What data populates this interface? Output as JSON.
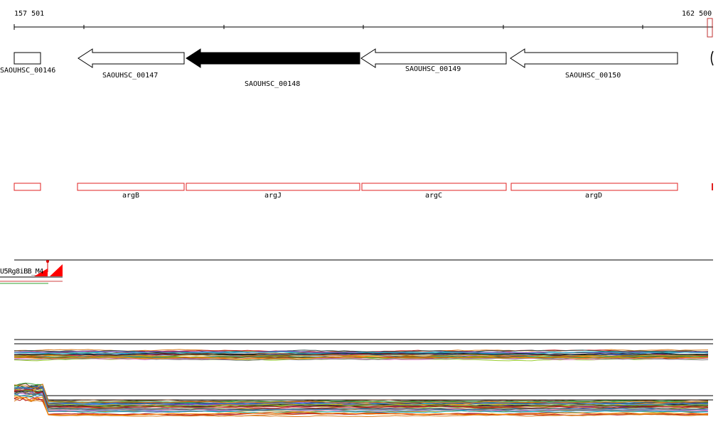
{
  "ruler": {
    "start_label": "157 501",
    "end_label": "162 500"
  },
  "genes": [
    {
      "locus": "SAOUHSC_00146",
      "strand": "+",
      "selected": false
    },
    {
      "locus": "SAOUHSC_00147",
      "strand": "-",
      "selected": false
    },
    {
      "locus": "SAOUHSC_00148",
      "strand": "-",
      "selected": true
    },
    {
      "locus": "SAOUHSC_00149",
      "strand": "-",
      "selected": false
    },
    {
      "locus": "SAOUHSC_00150",
      "strand": "-",
      "selected": false
    }
  ],
  "annotations": [
    {
      "name": ""
    },
    {
      "name": "argB"
    },
    {
      "name": "argJ"
    },
    {
      "name": "argC"
    },
    {
      "name": "argD"
    }
  ],
  "cluster_track": {
    "label": "U5Rg8iBB_M4"
  },
  "colors": {
    "gene_fill_selected": "#000000",
    "gene_fill": "#ffffff",
    "annotation_box": "#e02020",
    "peak": "#ff0000",
    "rule_line": "#000000"
  },
  "profile_series_colors": [
    "#3a6fd8",
    "#d87a1a",
    "#3aa03a",
    "#c02020",
    "#8040c0",
    "#6b3b1b",
    "#e070c0",
    "#808080",
    "#a0a020",
    "#20b0c0",
    "#1a1a1a",
    "#ff8c00",
    "#2f4f4f",
    "#9acd32",
    "#b22222",
    "#4682b4"
  ]
}
